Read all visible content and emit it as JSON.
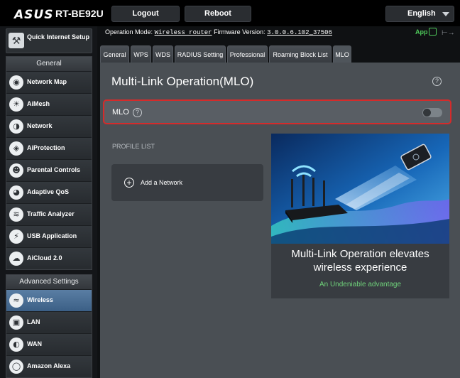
{
  "header": {
    "brand": "ASUS",
    "model": "RT-BE92U",
    "logout_label": "Logout",
    "reboot_label": "Reboot",
    "language": "English"
  },
  "info": {
    "op_mode_label": "Operation Mode:",
    "op_mode_value": "Wireless router",
    "fw_label": "Firmware Version:",
    "fw_value": "3.0.0.6.102_37506",
    "app_label": "App"
  },
  "sidebar": {
    "quick_label": "Quick Internet Setup",
    "general_heading": "General",
    "general_items": [
      {
        "label": "Network Map",
        "icon": "network-map-icon"
      },
      {
        "label": "AiMesh",
        "icon": "aimesh-icon"
      },
      {
        "label": "Network",
        "icon": "network-globe-icon"
      },
      {
        "label": "AiProtection",
        "icon": "shield-lock-icon"
      },
      {
        "label": "Parental Controls",
        "icon": "family-icon"
      },
      {
        "label": "Adaptive QoS",
        "icon": "speedometer-icon"
      },
      {
        "label": "Traffic Analyzer",
        "icon": "analyzer-icon"
      },
      {
        "label": "USB Application",
        "icon": "usb-icon"
      },
      {
        "label": "AiCloud 2.0",
        "icon": "cloud-icon"
      }
    ],
    "advanced_heading": "Advanced Settings",
    "advanced_items": [
      {
        "label": "Wireless",
        "icon": "wifi-icon"
      },
      {
        "label": "LAN",
        "icon": "lan-icon"
      },
      {
        "label": "WAN",
        "icon": "wan-globe-icon"
      },
      {
        "label": "Amazon Alexa",
        "icon": "alexa-icon"
      }
    ]
  },
  "tabs": [
    "General",
    "WPS",
    "WDS",
    "RADIUS Setting",
    "Professional",
    "Roaming Block List",
    "MLO"
  ],
  "active_tab": "MLO",
  "main": {
    "title": "Multi-Link Operation(MLO)",
    "mlo_label": "MLO",
    "mlo_enabled": false,
    "profile_list_label": "PROFILE LIST",
    "add_network_label": "Add a Network",
    "promo_line1": "Multi-Link Operation elevates",
    "promo_line2": "wireless experience",
    "promo_sub": "An Undeniable advantage"
  },
  "colors": {
    "accent_green": "#6fd17a",
    "highlight_red": "#d52b2b",
    "active_nav": "#4a6e95"
  }
}
